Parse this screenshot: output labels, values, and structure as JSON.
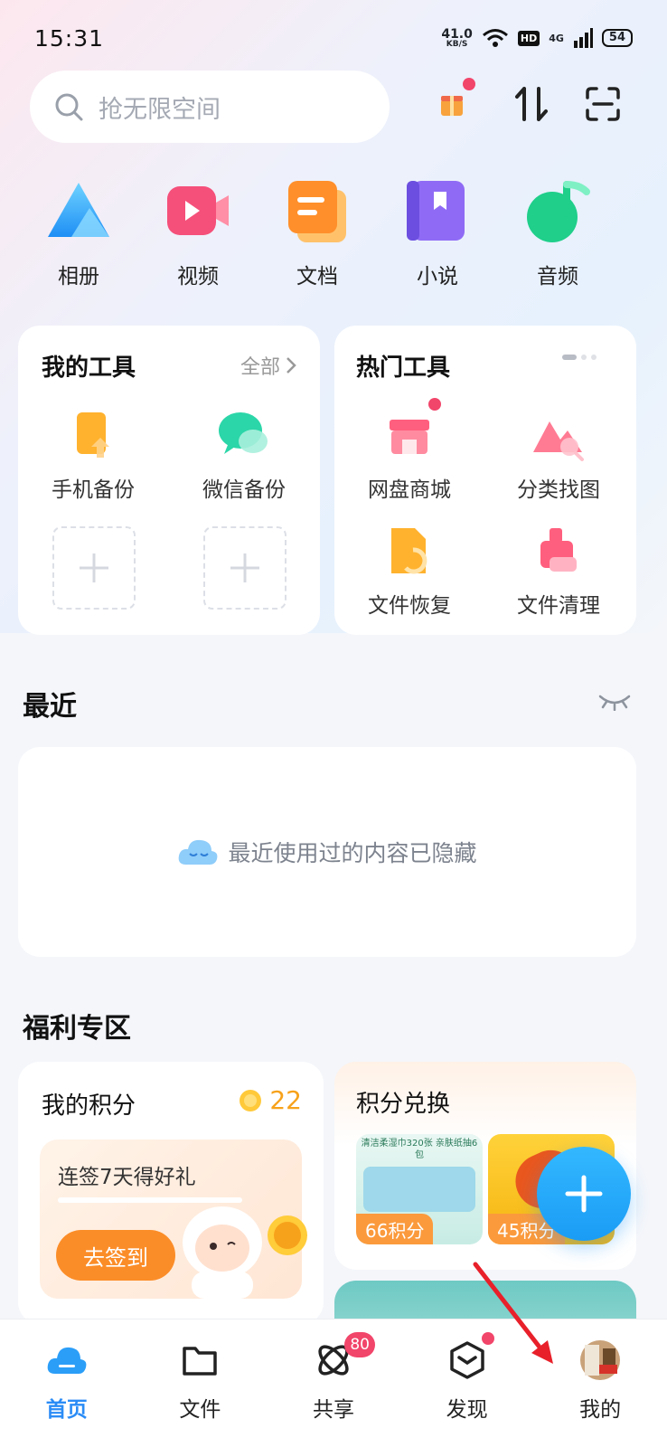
{
  "status_bar": {
    "time": "15:31",
    "net_speed_value": "41.0",
    "net_speed_unit": "KB/S",
    "hd_badge": "HD",
    "network": "4G",
    "battery": "54"
  },
  "search": {
    "placeholder": "抢无限空间"
  },
  "categories": [
    {
      "label": "相册",
      "icon": "album-icon"
    },
    {
      "label": "视频",
      "icon": "video-icon"
    },
    {
      "label": "文档",
      "icon": "document-icon"
    },
    {
      "label": "小说",
      "icon": "novel-icon"
    },
    {
      "label": "音频",
      "icon": "audio-icon"
    }
  ],
  "my_tools": {
    "title": "我的工具",
    "all_link": "全部",
    "items": [
      {
        "label": "手机备份",
        "icon": "phone-backup-icon"
      },
      {
        "label": "微信备份",
        "icon": "wechat-backup-icon"
      }
    ]
  },
  "hot_tools": {
    "title": "热门工具",
    "items": [
      {
        "label": "网盘商城",
        "icon": "store-icon"
      },
      {
        "label": "分类找图",
        "icon": "image-search-icon"
      },
      {
        "label": "文件恢复",
        "icon": "file-recover-icon"
      },
      {
        "label": "文件清理",
        "icon": "file-clean-icon"
      }
    ]
  },
  "recent": {
    "title": "最近",
    "hidden_message": "最近使用过的内容已隐藏"
  },
  "welfare": {
    "title": "福利专区",
    "points_card": {
      "title": "我的积分",
      "points": "22",
      "checkin_text": "连签7天得好礼",
      "checkin_button": "去签到"
    },
    "exchange_card": {
      "title": "积分兑换",
      "product_1_text": "清洁柔湿巾320张 亲肤纸抽6包",
      "product_1_points": "66积分",
      "product_2_points": "45积分"
    }
  },
  "bottom_nav": [
    {
      "label": "首页",
      "active": true
    },
    {
      "label": "文件",
      "active": false
    },
    {
      "label": "共享",
      "badge": "80",
      "active": false
    },
    {
      "label": "发现",
      "active": false
    },
    {
      "label": "我的",
      "active": false
    }
  ],
  "colors": {
    "accent_blue": "#2b8cf6",
    "badge_red": "#f2456a",
    "checkin_orange": "#fb8d28"
  }
}
